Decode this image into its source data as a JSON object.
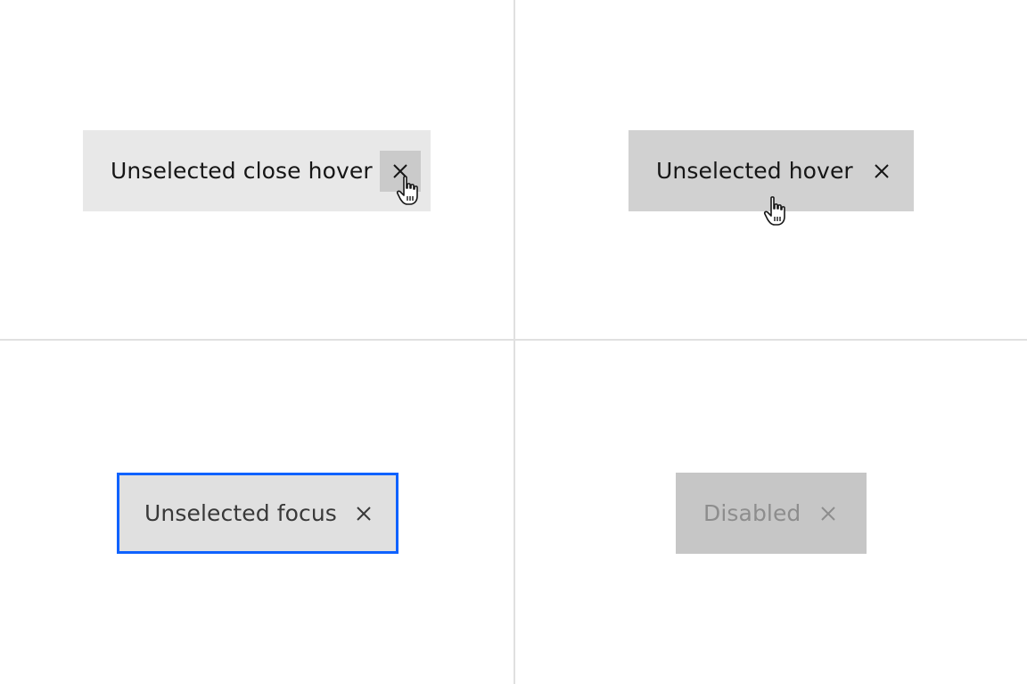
{
  "tags": {
    "close_hover": {
      "label": "Unselected close hover",
      "close_icon": "close-icon"
    },
    "hover": {
      "label": "Unselected hover",
      "close_icon": "close-icon"
    },
    "focus": {
      "label": "Unselected focus",
      "close_icon": "close-icon"
    },
    "disabled": {
      "label": "Disabled",
      "close_icon": "close-icon"
    }
  },
  "colors": {
    "focus_border": "#0f62fe",
    "close_hover_bg": "#e8e8e8",
    "hover_bg": "#d1d1d1",
    "focus_bg": "#e0e0e0",
    "disabled_bg": "#c6c6c6",
    "disabled_text": "#8d8d8d"
  },
  "cursor_icon": "hand-pointer-icon"
}
